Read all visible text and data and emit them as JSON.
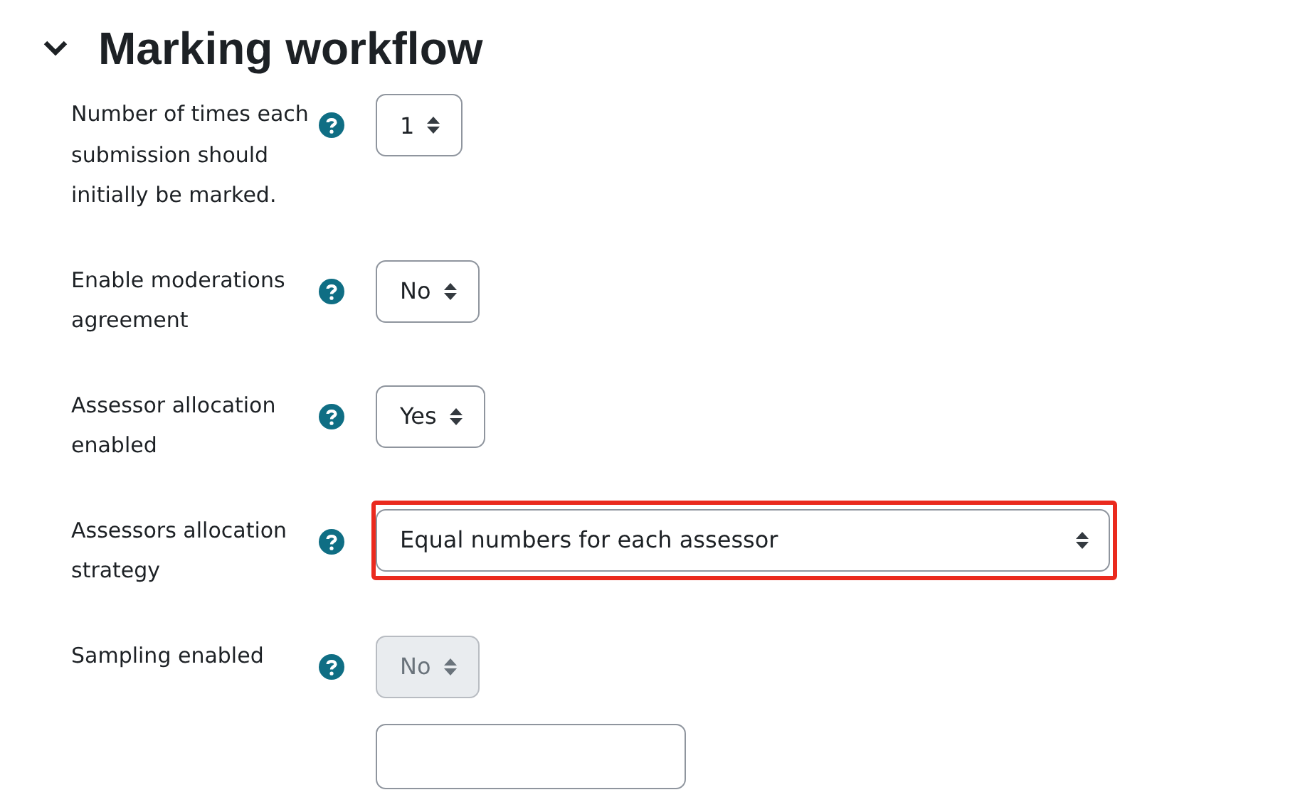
{
  "section": {
    "title": "Marking workflow",
    "expanded": true
  },
  "fields": [
    {
      "label": "Number of times each submission should initially be marked.",
      "value": "1",
      "wide": false,
      "disabled": false,
      "highlighted": false
    },
    {
      "label": "Enable moderations agreement",
      "value": "No",
      "wide": false,
      "disabled": false,
      "highlighted": false
    },
    {
      "label": "Assessor allocation enabled",
      "value": "Yes",
      "wide": false,
      "disabled": false,
      "highlighted": false
    },
    {
      "label": "Assessors allocation strategy",
      "value": "Equal numbers for each assessor",
      "wide": true,
      "disabled": false,
      "highlighted": true
    },
    {
      "label": "Sampling enabled",
      "value": "No",
      "wide": false,
      "disabled": true,
      "highlighted": false
    }
  ]
}
